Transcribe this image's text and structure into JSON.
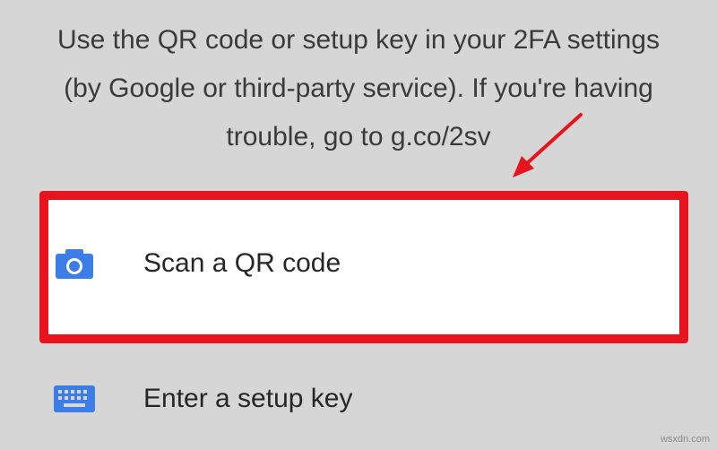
{
  "instructions": {
    "line1": "Use the QR code or setup key in your 2FA settings",
    "line2": "(by Google or third-party service). If you're having",
    "line3": "trouble, go to g.co/2sv"
  },
  "options": {
    "scan_qr": {
      "label": "Scan a QR code",
      "icon": "camera-icon"
    },
    "setup_key": {
      "label": "Enter a setup key",
      "icon": "keyboard-icon"
    }
  },
  "annotation": {
    "highlight_color": "#e8131c",
    "arrow_color": "#e8131c"
  },
  "colors": {
    "accent": "#3d7de8",
    "background": "#d6d6d6"
  },
  "watermark": "wsxdn.com"
}
